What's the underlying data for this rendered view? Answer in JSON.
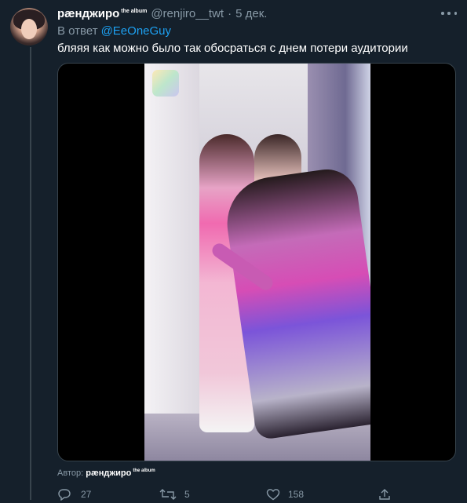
{
  "tweet": {
    "author_name": "рæнджиро",
    "author_sup": "the album",
    "handle": "@renjiro__twt",
    "separator": "·",
    "date": "5 дек.",
    "reply_prefix": "В ответ",
    "reply_to": "@EeOneGuy",
    "text": "бляяя как можно было так обосраться с днем потери аудитории"
  },
  "media": {
    "type": "video",
    "logo_icon": "show-champion-logo"
  },
  "footer": {
    "credit_prefix": "Автор:",
    "credit_name": "рæнджиро",
    "credit_sup": "the album"
  },
  "actions": {
    "reply_count": "27",
    "retweet_count": "5",
    "like_count": "158"
  },
  "colors": {
    "background": "#15202b",
    "accent": "#1da1f2",
    "muted": "#8899a6",
    "border": "#38444d"
  },
  "icons": [
    "more-icon",
    "reply-icon",
    "retweet-icon",
    "like-icon",
    "share-icon"
  ]
}
